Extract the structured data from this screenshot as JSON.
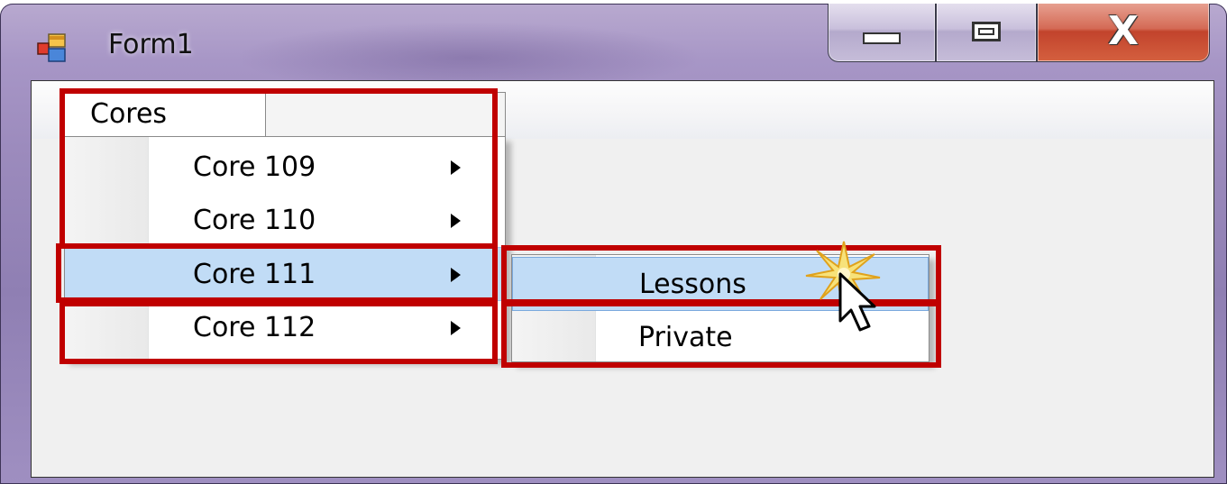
{
  "window": {
    "title": "Form1",
    "close_glyph": "X",
    "icon": "app-form-icon",
    "colors": {
      "frame": "#9c8bbd",
      "close": "#c2432c",
      "highlight": "#c1dcf6",
      "annotation": "#c00000"
    }
  },
  "menu": {
    "top_label": "Cores",
    "items": [
      {
        "label": "Core 109",
        "has_submenu": true,
        "highlighted": false
      },
      {
        "label": "Core 110",
        "has_submenu": true,
        "highlighted": false
      },
      {
        "label": "Core 111",
        "has_submenu": true,
        "highlighted": true
      },
      {
        "label": "Core 112",
        "has_submenu": true,
        "highlighted": false
      }
    ],
    "submenu": {
      "items": [
        {
          "label": "Lessons",
          "highlighted": true
        },
        {
          "label": "Private",
          "highlighted": false
        }
      ]
    }
  },
  "cursor": {
    "icon": "arrow-cursor-icon",
    "effect": "click-burst-icon"
  }
}
